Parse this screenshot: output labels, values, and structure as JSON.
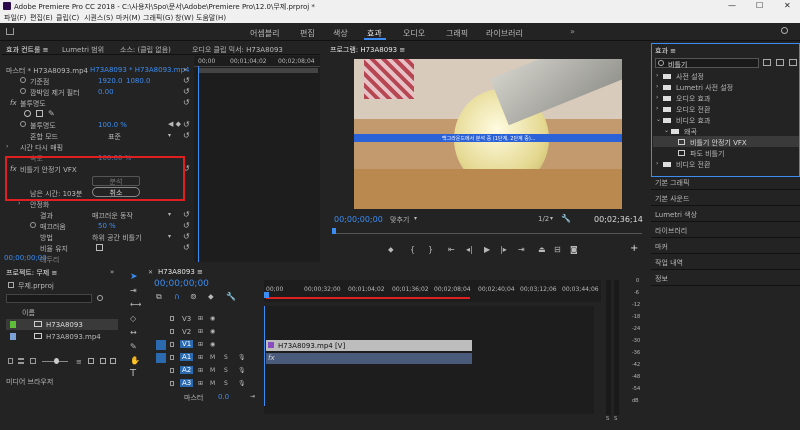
{
  "titlebar": {
    "title": "Adobe Premiere Pro CC 2018 - C:\\사용자\\Spo\\문서\\Adobe\\Premiere Pro\\12.0\\무제.prproj *",
    "min": "—",
    "max": "☐",
    "close": "✕"
  },
  "menu": [
    "파일(F)",
    "편집(E)",
    "클립(C)",
    "시퀀스(S)",
    "마커(M)",
    "그래픽(G)",
    "창(W)",
    "도움말(H)"
  ],
  "workspaces": [
    "어셈블리",
    "편집",
    "색상",
    "효과",
    "오디오",
    "그래픽",
    "라이브러리"
  ],
  "workspace_active": "효과",
  "effect_controls": {
    "tabs": [
      "효과 컨트롤 ≡",
      "Lumetri 범위",
      "소스: (클립 없음)",
      "오디오 클립 믹서: H73A8093"
    ],
    "master_label": "마스터 * H73A8093.mp4",
    "sequence_label": "H73A8093 * H73A8093.mp4",
    "ruler": [
      "00;00",
      "00;01;04;02",
      "00;02;08;04"
    ],
    "props": [
      {
        "name": "기준점",
        "v1": "1920.0",
        "v2": "1080.0"
      },
      {
        "name": "깜박임 제거 필터",
        "v1": "0.00",
        "v2": ""
      },
      {
        "name": "불투명도",
        "v1": "",
        "v2": ""
      },
      {
        "name": "",
        "v1": "",
        "v2": ""
      },
      {
        "name": "불투명도",
        "v1": "100.0 %",
        "v2": ""
      },
      {
        "name": "혼합 모드",
        "v1": "표준",
        "v2": ""
      },
      {
        "name": "시간 다시 매핑",
        "v1": "",
        "v2": ""
      },
      {
        "name": "속도",
        "v1": "100.00 %",
        "v2": ""
      }
    ],
    "fx_name": "비틀기 안정기 VFX",
    "analyze_btn": "분석",
    "remaining": "남은 시간: 103분",
    "cancel_btn": "취소",
    "stabilize": "안정화",
    "stab_rows": [
      {
        "name": "결과",
        "value": "매끄러운 동작"
      },
      {
        "name": "매끄러움",
        "value": "50 %"
      },
      {
        "name": "방법",
        "value": "하위 공간 비틀기"
      },
      {
        "name": "비율 유지",
        "value": ""
      },
      {
        "name": "테두리",
        "value": ""
      }
    ],
    "timecode": "00;00;00;00"
  },
  "program": {
    "title": "프로그램: H73A8093 ≡",
    "overlay_text": "백그라운드에서 분석 중 (1단계, 2단계 중)...",
    "timecode_left": "00;00;00;00",
    "fit": "맞추기",
    "quality": "1/2",
    "timecode_right": "00;02;36;14"
  },
  "effects": {
    "title": "효과 ≡",
    "search": "비틀기",
    "tree": [
      {
        "label": "사전 설정",
        "level": 0
      },
      {
        "label": "Lumetri 사전 설정",
        "level": 0
      },
      {
        "label": "오디오 효과",
        "level": 0
      },
      {
        "label": "오디오 전환",
        "level": 0
      },
      {
        "label": "비디오 효과",
        "level": 0
      },
      {
        "label": "왜곡",
        "level": 1
      },
      {
        "label": "비틀기 안정기 VFX",
        "level": 2
      },
      {
        "label": "파도 비틀기",
        "level": 2
      },
      {
        "label": "비디오 전환",
        "level": 0
      }
    ],
    "panels": [
      "기본 그래픽",
      "기본 사운드",
      "Lumetri 색상",
      "라이브러리",
      "마커",
      "작업 내역",
      "정보"
    ]
  },
  "project": {
    "title": "프로젝트: 무제 ≡",
    "file": "무제.prproj",
    "col_name": "이름",
    "items": [
      "H73A8093",
      "H73A8093.mp4"
    ],
    "media_browser": "미디어 브라우저"
  },
  "timeline": {
    "tab": "H73A8093 ≡",
    "timecode": "00;00;00;00",
    "ruler": [
      "00;00",
      "00;00;32;00",
      "00;01;04;02",
      "00;01;36;02",
      "00;02;08;04",
      "00;02;40;04",
      "00;03;12;06",
      "00;03;44;06"
    ],
    "tracks": [
      {
        "id": "V3",
        "type": "video"
      },
      {
        "id": "V2",
        "type": "video"
      },
      {
        "id": "V1",
        "type": "video"
      },
      {
        "id": "A1",
        "type": "audio"
      },
      {
        "id": "A2",
        "type": "audio"
      },
      {
        "id": "A3",
        "type": "audio"
      }
    ],
    "master": "마스터",
    "master_val": "0.0",
    "clip_label": "H73A8093.mp4 [V]",
    "audio_clip_label": "fx"
  },
  "meter": [
    "0",
    "-6",
    "-12",
    "-18",
    "-24",
    "-30",
    "-36",
    "-42",
    "-48",
    "-54",
    "dB"
  ],
  "colors": {
    "accent": "#3b8df3",
    "highlight": "#e02020",
    "clip": "#bdbdbd"
  }
}
